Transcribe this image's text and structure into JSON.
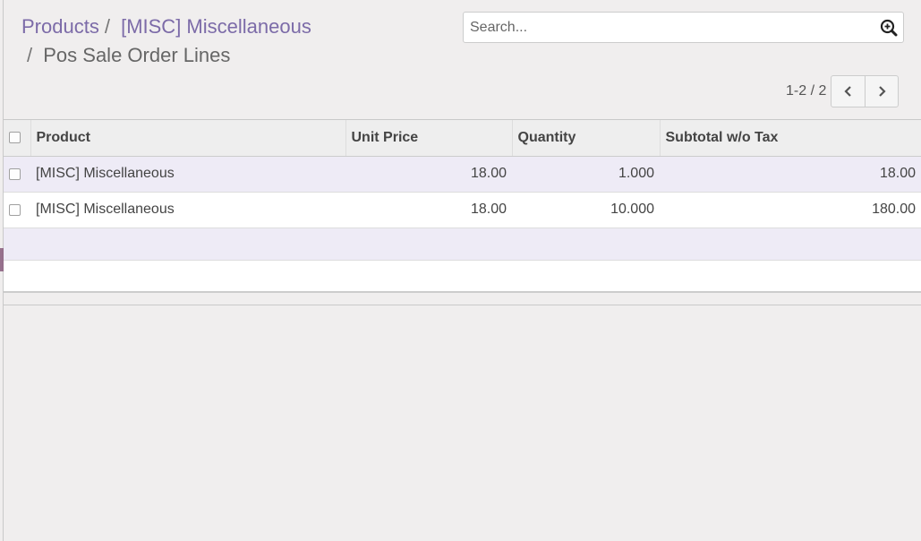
{
  "breadcrumb": {
    "items": [
      "Products",
      "[MISC] Miscellaneous"
    ],
    "separator": "/",
    "active": "Pos Sale Order Lines"
  },
  "search": {
    "placeholder": "Search...",
    "icon": "search-plus-icon"
  },
  "pager": {
    "value": "1-2 / 2",
    "prev_icon": "chevron-left-icon",
    "next_icon": "chevron-right-icon"
  },
  "table": {
    "columns": [
      "Product",
      "Unit Price",
      "Quantity",
      "Subtotal w/o Tax"
    ],
    "rows": [
      {
        "product": "[MISC] Miscellaneous",
        "unit_price": "18.00",
        "quantity": "1.000",
        "subtotal": "18.00"
      },
      {
        "product": "[MISC] Miscellaneous",
        "unit_price": "18.00",
        "quantity": "10.000",
        "subtotal": "180.00"
      }
    ]
  },
  "colors": {
    "link": "#7c6ba8",
    "row_highlight": "#eeebf6",
    "accent": "#875a7b"
  }
}
